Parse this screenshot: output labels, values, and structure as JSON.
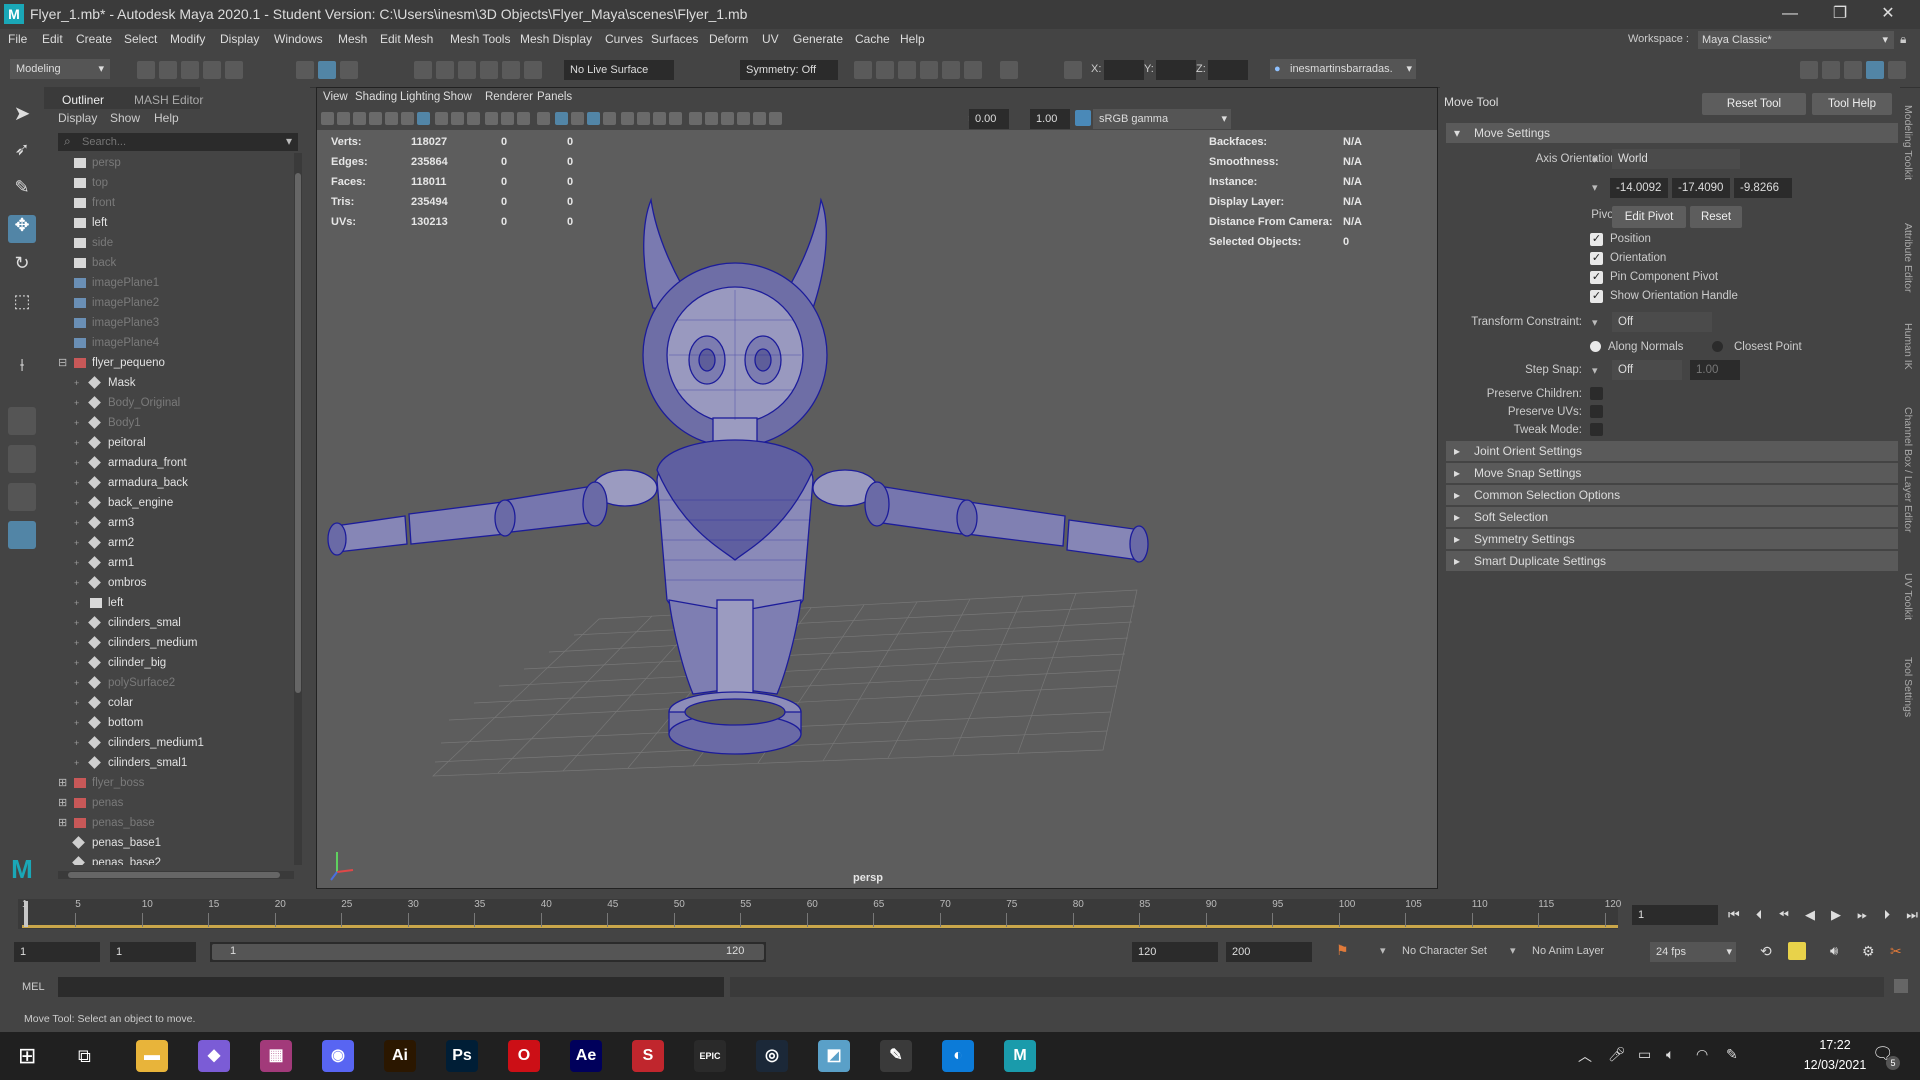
{
  "title_bar": {
    "logo": "M",
    "title": "Flyer_1.mb* - Autodesk Maya 2020.1 - Student Version: C:\\Users\\inesm\\3D Objects\\Flyer_Maya\\scenes\\Flyer_1.mb",
    "minimize": "—",
    "maximize": "❐",
    "close": "✕"
  },
  "menus": [
    "File",
    "Edit",
    "Create",
    "Select",
    "Modify",
    "Display",
    "Windows",
    "Mesh",
    "Edit Mesh",
    "Mesh Tools",
    "Mesh Display",
    "Curves",
    "Surfaces",
    "Deform",
    "UV",
    "Generate",
    "Cache",
    "Help"
  ],
  "workspace": {
    "label": "Workspace :",
    "value": "Maya Classic*"
  },
  "status_line": {
    "mode": "Modeling",
    "live_surface": "No Live Surface",
    "symmetry": "Symmetry: Off",
    "x_label": "X:",
    "y_label": "Y:",
    "z_label": "Z:",
    "user": "inesmartinsbarradas."
  },
  "outliner": {
    "tabs": [
      "Outliner",
      "MASH Editor"
    ],
    "menu": [
      "Display",
      "Show",
      "Help"
    ],
    "search_placeholder": "Search...",
    "items": [
      {
        "label": "persp",
        "dim": true,
        "type": "camera",
        "indent": 0
      },
      {
        "label": "top",
        "dim": true,
        "type": "camera",
        "indent": 0
      },
      {
        "label": "front",
        "dim": true,
        "type": "camera",
        "indent": 0
      },
      {
        "label": "left",
        "dim": false,
        "type": "camera",
        "indent": 0
      },
      {
        "label": "side",
        "dim": true,
        "type": "camera",
        "indent": 0
      },
      {
        "label": "back",
        "dim": true,
        "type": "camera",
        "indent": 0
      },
      {
        "label": "imagePlane1",
        "dim": true,
        "type": "plane",
        "indent": 0
      },
      {
        "label": "imagePlane2",
        "dim": true,
        "type": "plane",
        "indent": 0
      },
      {
        "label": "imagePlane3",
        "dim": true,
        "type": "plane",
        "indent": 0
      },
      {
        "label": "imagePlane4",
        "dim": true,
        "type": "plane",
        "indent": 0
      },
      {
        "label": "flyer_pequeno",
        "dim": false,
        "type": "group",
        "indent": 0,
        "expander": "−"
      },
      {
        "label": "Mask",
        "dim": false,
        "type": "mesh",
        "indent": 1
      },
      {
        "label": "Body_Original",
        "dim": true,
        "type": "mesh",
        "indent": 1
      },
      {
        "label": "Body1",
        "dim": true,
        "type": "mesh",
        "indent": 1
      },
      {
        "label": "peitoral",
        "dim": false,
        "type": "mesh",
        "indent": 1
      },
      {
        "label": "armadura_front",
        "dim": false,
        "type": "mesh",
        "indent": 1
      },
      {
        "label": "armadura_back",
        "dim": false,
        "type": "mesh",
        "indent": 1
      },
      {
        "label": "back_engine",
        "dim": false,
        "type": "mesh",
        "indent": 1
      },
      {
        "label": "arm3",
        "dim": false,
        "type": "mesh",
        "indent": 1
      },
      {
        "label": "arm2",
        "dim": false,
        "type": "mesh",
        "indent": 1
      },
      {
        "label": "arm1",
        "dim": false,
        "type": "mesh",
        "indent": 1
      },
      {
        "label": "ombros",
        "dim": false,
        "type": "mesh",
        "indent": 1
      },
      {
        "label": "left",
        "dim": false,
        "type": "camera",
        "indent": 1
      },
      {
        "label": "cilinders_smal",
        "dim": false,
        "type": "mesh",
        "indent": 1
      },
      {
        "label": "cilinders_medium",
        "dim": false,
        "type": "mesh",
        "indent": 1
      },
      {
        "label": "cilinder_big",
        "dim": false,
        "type": "mesh",
        "indent": 1
      },
      {
        "label": "polySurface2",
        "dim": true,
        "type": "mesh",
        "indent": 1
      },
      {
        "label": "colar",
        "dim": false,
        "type": "mesh",
        "indent": 1
      },
      {
        "label": "bottom",
        "dim": false,
        "type": "mesh",
        "indent": 1
      },
      {
        "label": "cilinders_medium1",
        "dim": false,
        "type": "mesh",
        "indent": 1
      },
      {
        "label": "cilinders_smal1",
        "dim": false,
        "type": "mesh",
        "indent": 1
      },
      {
        "label": "flyer_boss",
        "dim": true,
        "type": "group",
        "indent": 0,
        "expander": "+"
      },
      {
        "label": "penas",
        "dim": true,
        "type": "group",
        "indent": 0,
        "expander": "+"
      },
      {
        "label": "penas_base",
        "dim": true,
        "type": "group",
        "indent": 0,
        "expander": "+"
      },
      {
        "label": "penas_base1",
        "dim": false,
        "type": "mesh",
        "indent": 0
      },
      {
        "label": "penas_base2",
        "dim": false,
        "type": "mesh",
        "indent": 0
      }
    ]
  },
  "viewport": {
    "menu": [
      "View",
      "Shading",
      "Lighting",
      "Show",
      "Renderer",
      "Panels"
    ],
    "exposure": "0.00",
    "gamma": "1.00",
    "color_space": "sRGB gamma",
    "camera_label": "persp",
    "hud_left": [
      {
        "label": "Verts:",
        "v1": "118027",
        "v2": "0",
        "v3": "0"
      },
      {
        "label": "Edges:",
        "v1": "235864",
        "v2": "0",
        "v3": "0"
      },
      {
        "label": "Faces:",
        "v1": "118011",
        "v2": "0",
        "v3": "0"
      },
      {
        "label": "Tris:",
        "v1": "235494",
        "v2": "0",
        "v3": "0"
      },
      {
        "label": "UVs:",
        "v1": "130213",
        "v2": "0",
        "v3": "0"
      }
    ],
    "hud_right": [
      {
        "label": "Backfaces:",
        "value": "N/A"
      },
      {
        "label": "Smoothness:",
        "value": "N/A"
      },
      {
        "label": "Instance:",
        "value": "N/A"
      },
      {
        "label": "Display Layer:",
        "value": "N/A"
      },
      {
        "label": "Distance From Camera:",
        "value": "N/A"
      },
      {
        "label": "Selected Objects:",
        "value": "0"
      }
    ]
  },
  "tool_settings": {
    "title": "Move Tool",
    "reset_tool": "Reset Tool",
    "tool_help": "Tool Help",
    "move_settings": "Move Settings",
    "axis_orientation_label": "Axis Orientation:",
    "axis_orientation": "World",
    "coords": [
      "-14.0092",
      "-17.4090",
      "-9.8266"
    ],
    "pivot_label": "Pivot:",
    "edit_pivot": "Edit Pivot",
    "reset": "Reset",
    "checkboxes": [
      "Position",
      "Orientation",
      "Pin Component Pivot",
      "Show Orientation Handle"
    ],
    "transform_constraint_label": "Transform Constraint:",
    "transform_constraint": "Off",
    "along_normals": "Along Normals",
    "closest_point": "Closest Point",
    "step_snap_label": "Step Snap:",
    "step_snap": "Off",
    "step_snap_value": "1.00",
    "preserve_children": "Preserve Children:",
    "preserve_uvs": "Preserve UVs:",
    "tweak_mode": "Tweak Mode:",
    "sections": [
      "Joint Orient Settings",
      "Move Snap Settings",
      "Common Selection Options",
      "Soft Selection",
      "Symmetry Settings",
      "Smart Duplicate Settings"
    ],
    "side_tabs": [
      "Modeling Toolkit",
      "Attribute Editor",
      "Human IK",
      "Channel Box / Layer Editor",
      "UV Toolkit",
      "Tool Settings"
    ]
  },
  "timeline": {
    "ticks": [
      "5",
      "10",
      "15",
      "20",
      "25",
      "30",
      "35",
      "40",
      "45",
      "50",
      "55",
      "60",
      "65",
      "70",
      "75",
      "80",
      "85",
      "90",
      "95",
      "100",
      "105",
      "110",
      "115",
      "120"
    ],
    "start_tick": "1",
    "current_frame": "1"
  },
  "range": {
    "start": "1",
    "anim_start": "1",
    "slider_start": "1",
    "slider_end": "120",
    "end": "120",
    "anim_end": "200",
    "character_set": "No Character Set",
    "anim_layer": "No Anim Layer",
    "fps": "24 fps"
  },
  "cmdline": {
    "label": "MEL"
  },
  "help_line": "Move Tool: Select an object to move.",
  "taskbar": {
    "apps": [
      {
        "name": "file-explorer",
        "glyph": "▬",
        "color": "#e8b43a"
      },
      {
        "name": "visual-studio",
        "glyph": "◆",
        "color": "#7b5cd6"
      },
      {
        "name": "winrar",
        "glyph": "▦",
        "color": "#a23a7a"
      },
      {
        "name": "discord",
        "glyph": "◉",
        "color": "#5865f2"
      },
      {
        "name": "illustrator",
        "glyph": "Ai",
        "color": "#2b1700"
      },
      {
        "name": "photoshop",
        "glyph": "Ps",
        "color": "#001e36"
      },
      {
        "name": "opera",
        "glyph": "O",
        "color": "#cc0f16"
      },
      {
        "name": "after-effects",
        "glyph": "Ae",
        "color": "#00005b"
      },
      {
        "name": "substance",
        "glyph": "S",
        "color": "#c0262d"
      },
      {
        "name": "epic-games",
        "glyph": "EPIC",
        "color": "#2a2a2a"
      },
      {
        "name": "steam",
        "glyph": "◎",
        "color": "#1b2838"
      },
      {
        "name": "files",
        "glyph": "◩",
        "color": "#5aa0c8"
      },
      {
        "name": "paint",
        "glyph": "✎",
        "color": "#3a3a3a"
      },
      {
        "name": "edge",
        "glyph": "◐",
        "color": "#0c7bd8"
      },
      {
        "name": "maya",
        "glyph": "M",
        "color": "#1a9bab"
      }
    ],
    "time": "17:22",
    "date": "12/03/2021",
    "notifications": "5"
  }
}
